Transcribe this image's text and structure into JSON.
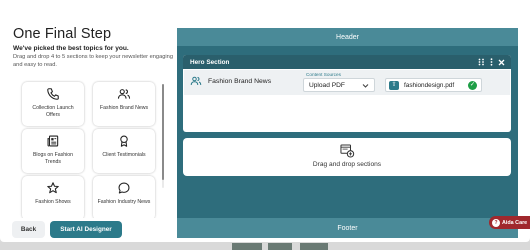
{
  "left": {
    "title": "One Final Step",
    "subtitle": "We've picked the best topics for you.",
    "description": "Drag and drop 4 to 5 sections to keep your newsletter engaging and easy to read.",
    "topics": [
      {
        "label": "Collection Launch Offers",
        "icon": "phone-icon"
      },
      {
        "label": "Fashion Brand News",
        "icon": "people-icon"
      },
      {
        "label": "Blogs on Fashion Trends",
        "icon": "newspaper-icon"
      },
      {
        "label": "Client Testimonials",
        "icon": "award-icon"
      },
      {
        "label": "Fashion Shows",
        "icon": "star-icon"
      },
      {
        "label": "Fashion Industry News",
        "icon": "chat-bubble-icon"
      }
    ],
    "back_label": "Back",
    "start_label": "Start AI Designer"
  },
  "right": {
    "header_label": "Header",
    "footer_label": "Footer",
    "hero": {
      "title": "Hero Section",
      "brand_name": "Fashion Brand News",
      "content_sources_label": "Content Sources",
      "content_source_value": "Upload PDF",
      "file_name": "fashiondesign.pdf"
    },
    "dropzone_label": "Drag and drop sections"
  },
  "aida_label": "Aida Care",
  "colors": {
    "accent": "#2c7a8a",
    "canvas": "#2e6d7c",
    "hero_bar": "#2a5f6c",
    "success": "#1e9e46",
    "aida": "#a0282d"
  }
}
